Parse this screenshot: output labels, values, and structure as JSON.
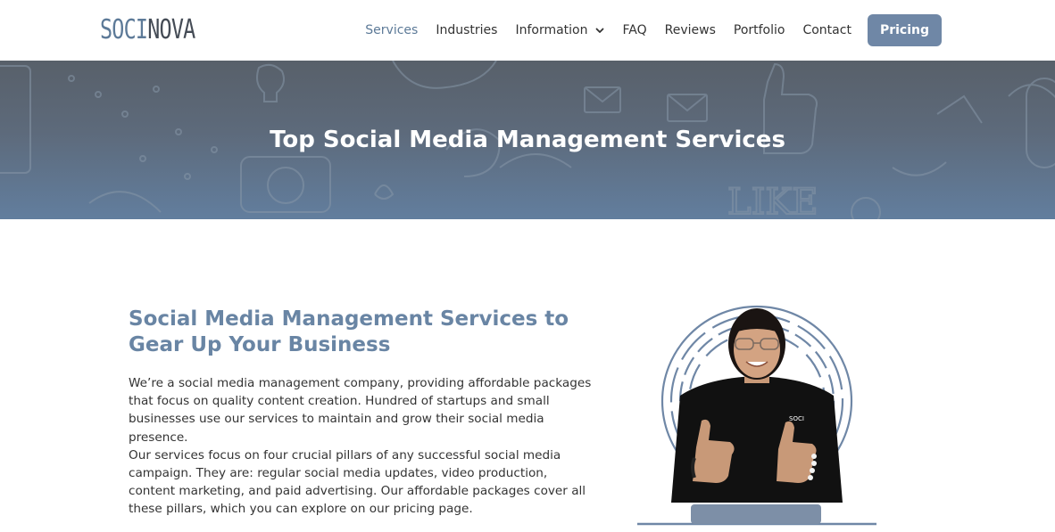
{
  "header": {
    "logo": {
      "part1": "SOCI",
      "part2": "NOVA"
    },
    "nav": [
      {
        "label": "Services",
        "active": true
      },
      {
        "label": "Industries"
      },
      {
        "label": "Information",
        "dropdown": true
      },
      {
        "label": "FAQ"
      },
      {
        "label": "Reviews"
      },
      {
        "label": "Portfolio"
      },
      {
        "label": "Contact"
      }
    ],
    "pricing_label": "Pricing"
  },
  "hero": {
    "title": "Top Social Media Management Services"
  },
  "content": {
    "heading": "Social Media Management Services to Gear Up Your Business",
    "paragraph1": "We’re a social media management company, providing affordable packages that focus on quality content creation. Hundred of startups and small businesses use our services to maintain and grow their social media presence.",
    "paragraph2": "Our services focus on four crucial pillars of any successful social media campaign. They are: regular social media updates, video production, content marketing, and paid advertising. Our affordable packages cover all these pillars, which you can explore on our pricing page.",
    "shirt_logo": "SOCI"
  },
  "colors": {
    "accent": "#6f87a6",
    "heading": "#6985a4",
    "nav_active": "#5d7a98",
    "text": "#333333"
  }
}
